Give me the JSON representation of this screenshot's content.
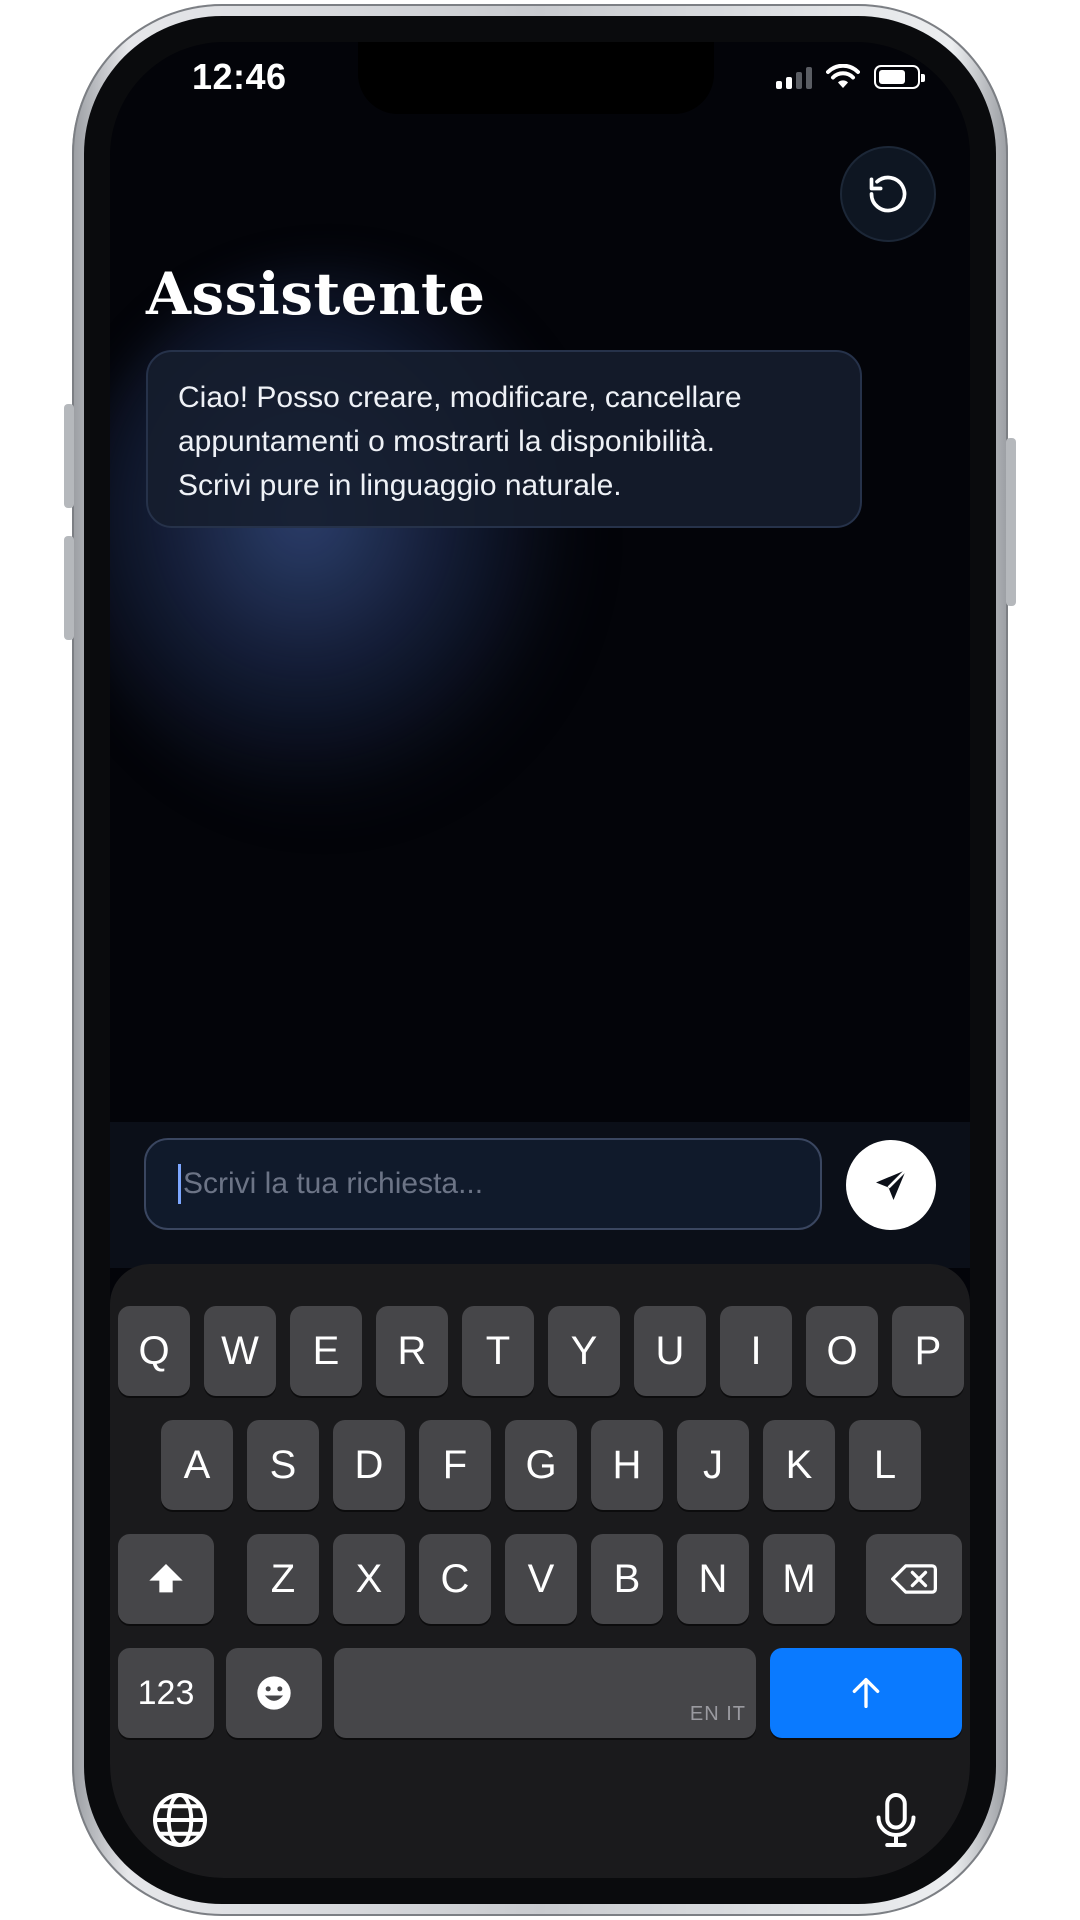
{
  "status_bar": {
    "time": "12:46"
  },
  "header": {
    "title": "Assistente",
    "reset_icon": "rotate-ccw-icon"
  },
  "chat": {
    "messages": [
      {
        "role": "assistant",
        "lines": [
          "Ciao! Posso creare, modificare, cancellare",
          "appuntamenti o mostrarti la disponibilità.",
          "Scrivi pure in linguaggio naturale."
        ]
      }
    ]
  },
  "composer": {
    "placeholder": "Scrivi la tua richiesta...",
    "send_icon": "send-icon"
  },
  "keyboard": {
    "row1": [
      "Q",
      "W",
      "E",
      "R",
      "T",
      "Y",
      "U",
      "I",
      "O",
      "P"
    ],
    "row2": [
      "A",
      "S",
      "D",
      "F",
      "G",
      "H",
      "J",
      "K",
      "L"
    ],
    "row3": [
      "Z",
      "X",
      "C",
      "V",
      "B",
      "N",
      "M"
    ],
    "numbers_label": "123",
    "space_languages": "EN IT",
    "icons": {
      "shift": "shift-icon",
      "delete": "backspace-icon",
      "emoji": "emoji-icon",
      "return": "arrow-up-icon",
      "globe": "globe-icon",
      "mic": "microphone-icon"
    }
  },
  "colors": {
    "screen_bg": "#030409",
    "bubble_bg": "#161e2e",
    "key_bg": "#464649",
    "return_key": "#0a7aff",
    "send_button": "#ffffff"
  }
}
